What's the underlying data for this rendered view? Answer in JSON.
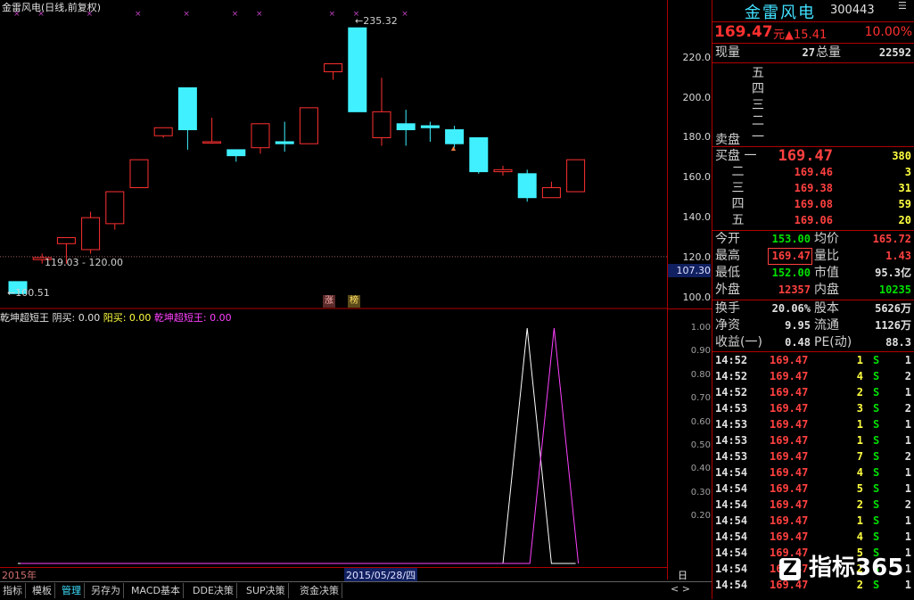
{
  "chart": {
    "title": "金雷风电(日线,前复权)",
    "high_label": "235.32",
    "low_label": "100.51",
    "range_label": "119.03 - 120.00",
    "badge_up": "涨",
    "badge_list": "榜",
    "candles": [
      {
        "o": 108,
        "h": 108,
        "l": 102,
        "c": 102
      },
      {
        "o": 119,
        "h": 122,
        "l": 117,
        "c": 120
      },
      {
        "o": 127,
        "h": 130,
        "l": 117,
        "c": 130
      },
      {
        "o": 124,
        "h": 143,
        "l": 122,
        "c": 140
      },
      {
        "o": 137,
        "h": 153,
        "l": 134,
        "c": 153
      },
      {
        "o": 155,
        "h": 169,
        "l": 155,
        "c": 169
      },
      {
        "o": 181,
        "h": 185,
        "l": 180,
        "c": 185
      },
      {
        "o": 205,
        "h": 205,
        "l": 174,
        "c": 184
      },
      {
        "o": 178,
        "h": 190,
        "l": 177,
        "c": 178
      },
      {
        "o": 174,
        "h": 174,
        "l": 168,
        "c": 171
      },
      {
        "o": 175,
        "h": 187,
        "l": 172,
        "c": 187
      },
      {
        "o": 178,
        "h": 188,
        "l": 173,
        "c": 177
      },
      {
        "o": 177,
        "h": 195,
        "l": 177,
        "c": 195
      },
      {
        "o": 213,
        "h": 217,
        "l": 209,
        "c": 217
      },
      {
        "o": 235,
        "h": 235,
        "l": 193,
        "c": 193
      },
      {
        "o": 180,
        "h": 210,
        "l": 176,
        "c": 193
      },
      {
        "o": 187,
        "h": 194,
        "l": 176,
        "c": 184
      },
      {
        "o": 186,
        "h": 188,
        "l": 178,
        "c": 185
      },
      {
        "o": 184,
        "h": 186,
        "l": 175,
        "c": 177
      },
      {
        "o": 180,
        "h": 180,
        "l": 162,
        "c": 163
      },
      {
        "o": 163,
        "h": 166,
        "l": 161,
        "c": 164
      },
      {
        "o": 162,
        "h": 164,
        "l": 148,
        "c": 150
      },
      {
        "o": 150,
        "h": 158,
        "l": 150,
        "c": 155
      },
      {
        "o": 153,
        "h": 169,
        "l": 153,
        "c": 169
      }
    ],
    "price_axis": [
      "220.0",
      "200.0",
      "180.0",
      "160.0",
      "140.0",
      "120.0",
      "100.0"
    ],
    "current_price_tag": "107.30",
    "price_min": 95,
    "price_max": 240
  },
  "indicator": {
    "name": "乾坤超短王",
    "yin_label": "阴买: 0.00",
    "yang_label": "阳买: 0.00",
    "series_label": "乾坤超短王: 0.00",
    "axis": [
      "1.00",
      "0.90",
      "0.80",
      "0.70",
      "0.60",
      "0.50",
      "0.40",
      "0.30",
      "0.20"
    ],
    "white_series": [
      0,
      0,
      0,
      0,
      0,
      0,
      0,
      0,
      0,
      0,
      0,
      0,
      0,
      0,
      0,
      0,
      0,
      0,
      0,
      0,
      0,
      1,
      0,
      0
    ],
    "magenta_series": [
      0,
      0,
      0,
      0,
      0,
      0,
      0,
      0,
      0,
      0,
      0,
      0,
      0,
      0,
      0,
      0,
      0,
      0,
      0,
      0,
      0,
      0,
      1,
      0
    ]
  },
  "date_strip": {
    "year": "2015年",
    "cursor_date": "2015/05/28/四",
    "period": "日线"
  },
  "tabs": [
    "指标",
    "模板",
    "管理",
    "另存为",
    "MACD基本",
    "DDE决策",
    "SUP决策",
    "资金决策"
  ],
  "active_tab": "管理",
  "stock": {
    "name": "金雷风电",
    "code": "300443",
    "price": "169.47",
    "unit": "元",
    "change": "▲15.41",
    "pct": "10.00%",
    "xianliang_label": "现量",
    "xianliang": "27",
    "zongliang_label": "总量",
    "zongliang": "22592"
  },
  "sell": {
    "label": "卖盘",
    "levels": [
      "五",
      "四",
      "三",
      "二",
      "一"
    ]
  },
  "buy": {
    "label": "买盘",
    "levels": [
      {
        "lv": "一",
        "price": "169.47",
        "vol": "380"
      },
      {
        "lv": "二",
        "price": "169.46",
        "vol": "3"
      },
      {
        "lv": "三",
        "price": "169.38",
        "vol": "31"
      },
      {
        "lv": "四",
        "price": "169.08",
        "vol": "59"
      },
      {
        "lv": "五",
        "price": "169.06",
        "vol": "20"
      }
    ]
  },
  "stats": [
    [
      {
        "l": "今开",
        "v": "153.00",
        "c": "green"
      },
      {
        "l": "均价",
        "v": "165.72",
        "c": "red"
      }
    ],
    [
      {
        "l": "最高",
        "v": "169.47",
        "c": "red"
      },
      {
        "l": "量比",
        "v": "1.43",
        "c": "red"
      }
    ],
    [
      {
        "l": "最低",
        "v": "152.00",
        "c": "green"
      },
      {
        "l": "市值",
        "v": "95.3亿",
        "c": "white"
      }
    ],
    [
      {
        "l": "外盘",
        "v": "12357",
        "c": "red"
      },
      {
        "l": "内盘",
        "v": "10235",
        "c": "green"
      }
    ]
  ],
  "stats2": [
    [
      {
        "l": "换手",
        "v": "20.06%",
        "c": "white"
      },
      {
        "l": "股本",
        "v": "5626万",
        "c": "white"
      }
    ],
    [
      {
        "l": "净资",
        "v": "9.95",
        "c": "white"
      },
      {
        "l": "流通",
        "v": "1126万",
        "c": "white"
      }
    ],
    [
      {
        "l": "收益(一)",
        "v": "0.48",
        "c": "white"
      },
      {
        "l": "PE(动)",
        "v": "88.3",
        "c": "white"
      }
    ]
  ],
  "ticks": [
    {
      "t": "14:52",
      "p": "169.47",
      "v": "1",
      "s": "S",
      "n": "1"
    },
    {
      "t": "14:52",
      "p": "169.47",
      "v": "4",
      "s": "S",
      "n": "2"
    },
    {
      "t": "14:52",
      "p": "169.47",
      "v": "2",
      "s": "S",
      "n": "1"
    },
    {
      "t": "14:53",
      "p": "169.47",
      "v": "3",
      "s": "S",
      "n": "2"
    },
    {
      "t": "14:53",
      "p": "169.47",
      "v": "1",
      "s": "S",
      "n": "1"
    },
    {
      "t": "14:53",
      "p": "169.47",
      "v": "1",
      "s": "S",
      "n": "1"
    },
    {
      "t": "14:53",
      "p": "169.47",
      "v": "7",
      "s": "S",
      "n": "2"
    },
    {
      "t": "14:54",
      "p": "169.47",
      "v": "4",
      "s": "S",
      "n": "1"
    },
    {
      "t": "14:54",
      "p": "169.47",
      "v": "5",
      "s": "S",
      "n": "1"
    },
    {
      "t": "14:54",
      "p": "169.47",
      "v": "2",
      "s": "S",
      "n": "2"
    },
    {
      "t": "14:54",
      "p": "169.47",
      "v": "1",
      "s": "S",
      "n": "1"
    },
    {
      "t": "14:54",
      "p": "169.47",
      "v": "4",
      "s": "S",
      "n": "1"
    },
    {
      "t": "14:54",
      "p": "169.47",
      "v": "5",
      "s": "S",
      "n": "1"
    },
    {
      "t": "14:54",
      "p": "169.47",
      "v": "2",
      "s": "S",
      "n": "1"
    },
    {
      "t": "14:54",
      "p": "169.47",
      "v": "2",
      "s": "S",
      "n": "1"
    }
  ],
  "watermark": "指标365"
}
